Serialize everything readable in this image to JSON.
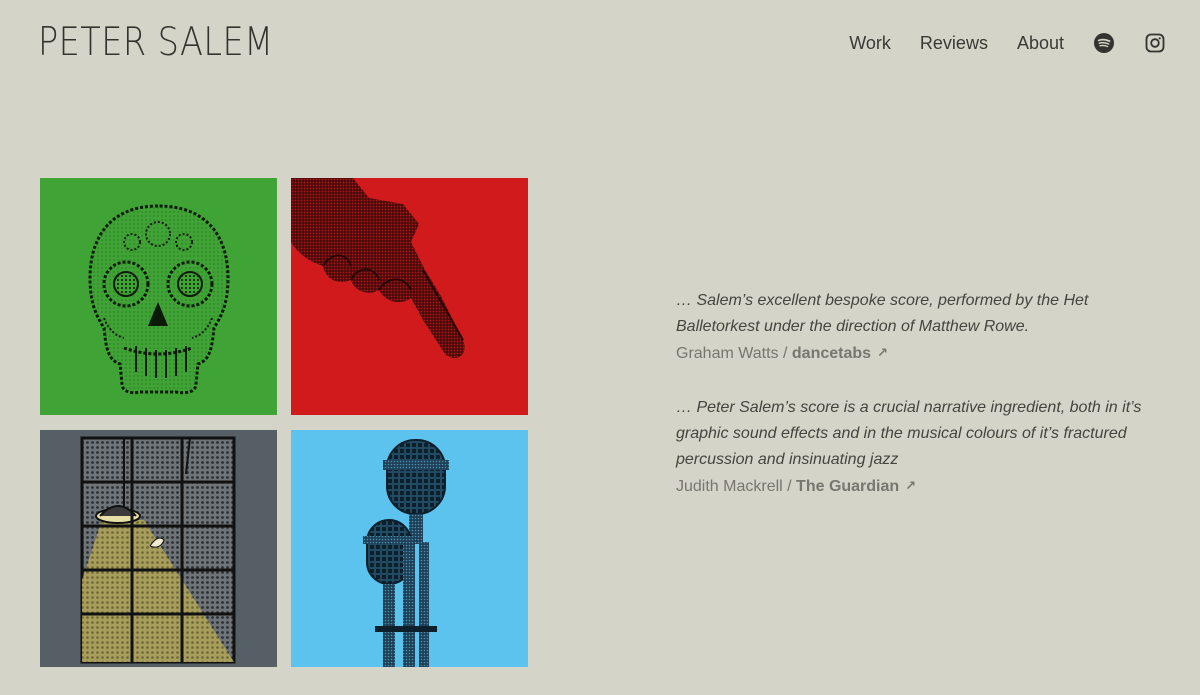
{
  "site": {
    "title": "PETER SALEM"
  },
  "nav": {
    "items": [
      {
        "label": "Work"
      },
      {
        "label": "Reviews"
      },
      {
        "label": "About"
      }
    ],
    "icons": [
      "spotify-icon",
      "instagram-icon"
    ]
  },
  "tiles": [
    {
      "name": "skull-artwork",
      "color": "#3fa435"
    },
    {
      "name": "pointing-finger-artwork",
      "color": "#d11a1b"
    },
    {
      "name": "window-lamp-artwork",
      "color": "#565e66"
    },
    {
      "name": "microphone-artwork",
      "color": "#5bc3ed"
    }
  ],
  "reviews": [
    {
      "quote": "… Salem’s excellent bespoke score, performed by the Het Balletorkest under the direction of Matthew Rowe.",
      "author": "Graham Watts",
      "separator": " / ",
      "source": "dancetabs",
      "arrow": "↗"
    },
    {
      "quote": "… Peter Salem’s score is a crucial narrative ingredient, both in it’s graphic sound effects and in the musical colours of it’s fractured percussion and insinuating jazz",
      "author": "Judith Mackrell",
      "separator": " / ",
      "source": "The Guardian",
      "arrow": "↗"
    }
  ],
  "colors": {
    "background": "#d5d4c8",
    "text": "#2f2e2a",
    "muted": "#77766f"
  }
}
